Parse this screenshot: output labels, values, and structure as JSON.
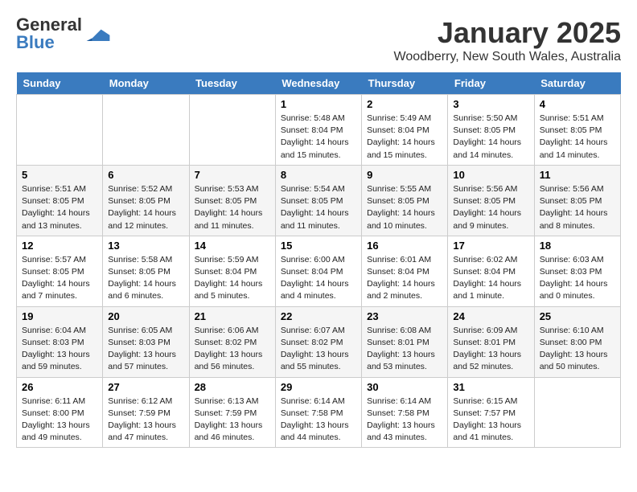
{
  "logo": {
    "general": "General",
    "blue": "Blue"
  },
  "title": "January 2025",
  "subtitle": "Woodberry, New South Wales, Australia",
  "days_of_week": [
    "Sunday",
    "Monday",
    "Tuesday",
    "Wednesday",
    "Thursday",
    "Friday",
    "Saturday"
  ],
  "weeks": [
    [
      {
        "num": "",
        "info": ""
      },
      {
        "num": "",
        "info": ""
      },
      {
        "num": "",
        "info": ""
      },
      {
        "num": "1",
        "info": "Sunrise: 5:48 AM\nSunset: 8:04 PM\nDaylight: 14 hours and 15 minutes."
      },
      {
        "num": "2",
        "info": "Sunrise: 5:49 AM\nSunset: 8:04 PM\nDaylight: 14 hours and 15 minutes."
      },
      {
        "num": "3",
        "info": "Sunrise: 5:50 AM\nSunset: 8:05 PM\nDaylight: 14 hours and 14 minutes."
      },
      {
        "num": "4",
        "info": "Sunrise: 5:51 AM\nSunset: 8:05 PM\nDaylight: 14 hours and 14 minutes."
      }
    ],
    [
      {
        "num": "5",
        "info": "Sunrise: 5:51 AM\nSunset: 8:05 PM\nDaylight: 14 hours and 13 minutes."
      },
      {
        "num": "6",
        "info": "Sunrise: 5:52 AM\nSunset: 8:05 PM\nDaylight: 14 hours and 12 minutes."
      },
      {
        "num": "7",
        "info": "Sunrise: 5:53 AM\nSunset: 8:05 PM\nDaylight: 14 hours and 11 minutes."
      },
      {
        "num": "8",
        "info": "Sunrise: 5:54 AM\nSunset: 8:05 PM\nDaylight: 14 hours and 11 minutes."
      },
      {
        "num": "9",
        "info": "Sunrise: 5:55 AM\nSunset: 8:05 PM\nDaylight: 14 hours and 10 minutes."
      },
      {
        "num": "10",
        "info": "Sunrise: 5:56 AM\nSunset: 8:05 PM\nDaylight: 14 hours and 9 minutes."
      },
      {
        "num": "11",
        "info": "Sunrise: 5:56 AM\nSunset: 8:05 PM\nDaylight: 14 hours and 8 minutes."
      }
    ],
    [
      {
        "num": "12",
        "info": "Sunrise: 5:57 AM\nSunset: 8:05 PM\nDaylight: 14 hours and 7 minutes."
      },
      {
        "num": "13",
        "info": "Sunrise: 5:58 AM\nSunset: 8:05 PM\nDaylight: 14 hours and 6 minutes."
      },
      {
        "num": "14",
        "info": "Sunrise: 5:59 AM\nSunset: 8:04 PM\nDaylight: 14 hours and 5 minutes."
      },
      {
        "num": "15",
        "info": "Sunrise: 6:00 AM\nSunset: 8:04 PM\nDaylight: 14 hours and 4 minutes."
      },
      {
        "num": "16",
        "info": "Sunrise: 6:01 AM\nSunset: 8:04 PM\nDaylight: 14 hours and 2 minutes."
      },
      {
        "num": "17",
        "info": "Sunrise: 6:02 AM\nSunset: 8:04 PM\nDaylight: 14 hours and 1 minute."
      },
      {
        "num": "18",
        "info": "Sunrise: 6:03 AM\nSunset: 8:03 PM\nDaylight: 14 hours and 0 minutes."
      }
    ],
    [
      {
        "num": "19",
        "info": "Sunrise: 6:04 AM\nSunset: 8:03 PM\nDaylight: 13 hours and 59 minutes."
      },
      {
        "num": "20",
        "info": "Sunrise: 6:05 AM\nSunset: 8:03 PM\nDaylight: 13 hours and 57 minutes."
      },
      {
        "num": "21",
        "info": "Sunrise: 6:06 AM\nSunset: 8:02 PM\nDaylight: 13 hours and 56 minutes."
      },
      {
        "num": "22",
        "info": "Sunrise: 6:07 AM\nSunset: 8:02 PM\nDaylight: 13 hours and 55 minutes."
      },
      {
        "num": "23",
        "info": "Sunrise: 6:08 AM\nSunset: 8:01 PM\nDaylight: 13 hours and 53 minutes."
      },
      {
        "num": "24",
        "info": "Sunrise: 6:09 AM\nSunset: 8:01 PM\nDaylight: 13 hours and 52 minutes."
      },
      {
        "num": "25",
        "info": "Sunrise: 6:10 AM\nSunset: 8:00 PM\nDaylight: 13 hours and 50 minutes."
      }
    ],
    [
      {
        "num": "26",
        "info": "Sunrise: 6:11 AM\nSunset: 8:00 PM\nDaylight: 13 hours and 49 minutes."
      },
      {
        "num": "27",
        "info": "Sunrise: 6:12 AM\nSunset: 7:59 PM\nDaylight: 13 hours and 47 minutes."
      },
      {
        "num": "28",
        "info": "Sunrise: 6:13 AM\nSunset: 7:59 PM\nDaylight: 13 hours and 46 minutes."
      },
      {
        "num": "29",
        "info": "Sunrise: 6:14 AM\nSunset: 7:58 PM\nDaylight: 13 hours and 44 minutes."
      },
      {
        "num": "30",
        "info": "Sunrise: 6:14 AM\nSunset: 7:58 PM\nDaylight: 13 hours and 43 minutes."
      },
      {
        "num": "31",
        "info": "Sunrise: 6:15 AM\nSunset: 7:57 PM\nDaylight: 13 hours and 41 minutes."
      },
      {
        "num": "",
        "info": ""
      }
    ]
  ]
}
